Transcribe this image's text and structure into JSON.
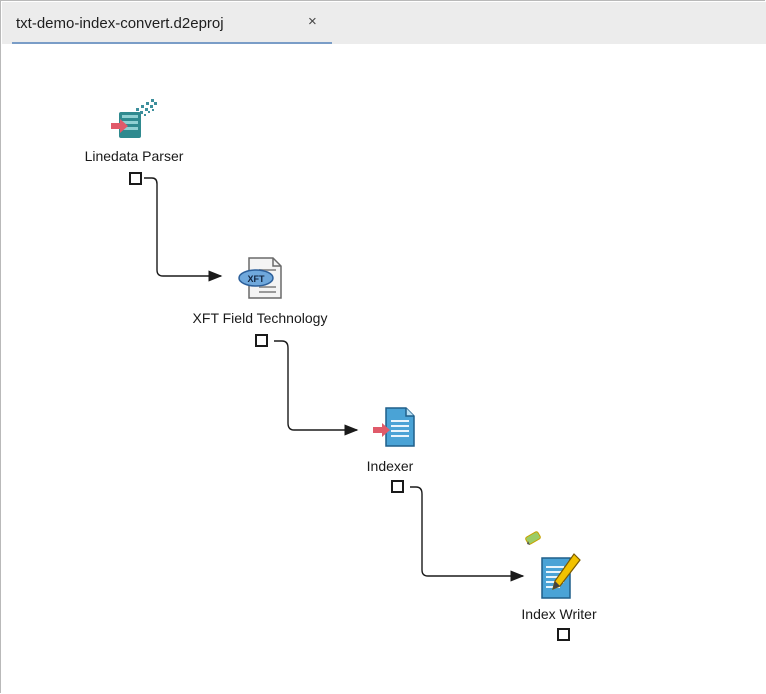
{
  "tab": {
    "title": "txt-demo-index-convert.d2eproj",
    "close_label": "×"
  },
  "nodes": [
    {
      "label": "Linedata Parser",
      "icon": "linedata-parser-icon"
    },
    {
      "label": "XFT Field Technology",
      "icon": "xft-field-technology-icon"
    },
    {
      "label": "Indexer",
      "icon": "indexer-icon"
    },
    {
      "label": "Index Writer",
      "icon": "index-writer-icon"
    }
  ],
  "extra_icons": [
    "edit-pencil-small-icon"
  ],
  "colors": {
    "tab_underline": "#7a9dc7",
    "connector": "#1a1a1a",
    "arrow_accent": "#e05a6a"
  }
}
